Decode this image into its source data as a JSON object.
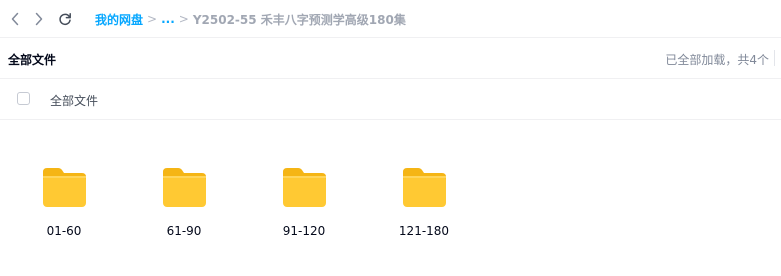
{
  "nav": {
    "back_icon": "chevron-left-icon",
    "forward_icon": "chevron-right-icon",
    "refresh_icon": "refresh-icon"
  },
  "breadcrumb": {
    "root": "我的网盘",
    "separator": ">",
    "ellipsis": "...",
    "current": "Y2502-55 禾丰八字预测学高级180集"
  },
  "header": {
    "title": "全部文件",
    "load_status": "已全部加载，共4个"
  },
  "select_all": {
    "label": "全部文件",
    "checked": false
  },
  "folders": [
    {
      "name": "01-60",
      "icon": "folder-icon"
    },
    {
      "name": "61-90",
      "icon": "folder-icon"
    },
    {
      "name": "91-120",
      "icon": "folder-icon"
    },
    {
      "name": "121-180",
      "icon": "folder-icon"
    }
  ],
  "colors": {
    "accent": "#06a7ff",
    "folder_body": "#ffc933",
    "folder_tab": "#f5b515"
  }
}
